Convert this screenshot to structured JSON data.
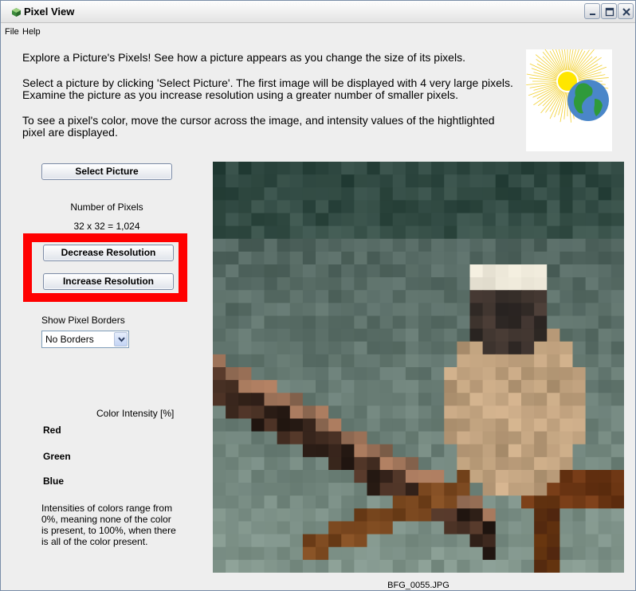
{
  "window": {
    "title": "Pixel View",
    "controls": {
      "minimize_icon": "minimize-icon",
      "maximize_icon": "maximize-icon",
      "close_icon": "close-icon"
    }
  },
  "menu": {
    "items": [
      "File",
      "Help"
    ]
  },
  "intro": {
    "p1": "Explore a Picture's Pixels!  See how a picture appears as you change the size of its pixels.",
    "p2": "Select a picture by clicking 'Select Picture'.  The first image will be displayed with 4 very large pixels.  Examine the picture as you increase resolution using a greater number of smaller pixels.",
    "p3": "To see a pixel's color, move the cursor across the image, and intensity values of the hightlighted pixel are displayed."
  },
  "controls": {
    "select_label": "Select Picture",
    "num_pixels_label": "Number of Pixels",
    "num_pixels_value": "32 x 32 = 1,024",
    "decrease_label": "Decrease Resolution",
    "increase_label": "Increase Resolution",
    "borders_label": "Show Pixel Borders",
    "borders_value": "No Borders"
  },
  "intensity": {
    "title": "Color Intensity [%]",
    "red": "Red",
    "green": "Green",
    "blue": "Blue",
    "note": "Intensities of colors range from 0%, meaning none of the color is present, to 100%, when there is all of the color present."
  },
  "image": {
    "filename": "BFG_0055.JPG",
    "grid": 32
  },
  "colors": {
    "highlight": "#ff0000",
    "window_bg": "#eeeeee"
  }
}
